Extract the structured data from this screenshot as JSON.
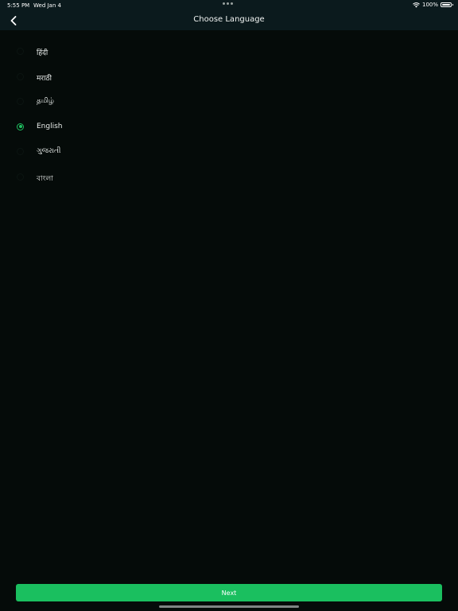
{
  "status_bar": {
    "time": "5:55 PM",
    "date": "Wed Jan 4",
    "battery": "100%",
    "battery_level": 1.0,
    "icons": [
      "wifi-icon",
      "battery-icon"
    ]
  },
  "nav": {
    "title": "Choose Language",
    "back_icon": "chevron-left-icon"
  },
  "languages": [
    {
      "label": "हिंदी",
      "selected": false
    },
    {
      "label": "मराठी",
      "selected": false
    },
    {
      "label": "தமிழ்",
      "selected": false
    },
    {
      "label": "English",
      "selected": true
    },
    {
      "label": "ગુજરાતી",
      "selected": false
    },
    {
      "label": "বাংলা",
      "selected": false
    }
  ],
  "footer": {
    "next_label": "Next"
  },
  "colors": {
    "background": "#050b09",
    "header": "#0b1a1d",
    "accent": "#1abf5f"
  }
}
